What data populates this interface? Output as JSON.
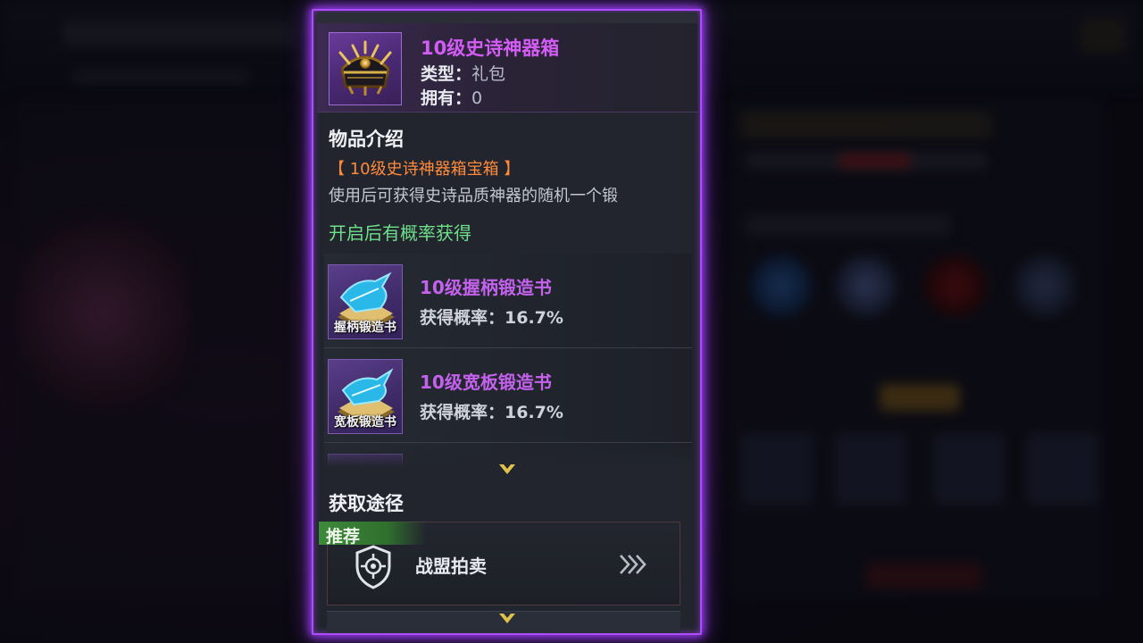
{
  "item": {
    "name": "10级史诗神器箱",
    "type_key": "类型：",
    "type_value": "礼包",
    "owned_key": "拥有：",
    "owned_value": "0",
    "icon": "ornate-chest-icon",
    "rarity_color": "#d45cf6"
  },
  "description": {
    "title": "物品介绍",
    "subtitle": "【 10级史诗神器箱宝箱 】",
    "text": "使用后可获得史诗品质神器的随机一个锻",
    "possible_rewards_label": "开启后有概率获得"
  },
  "rewards": [
    {
      "name": "10级握柄锻造书",
      "icon_label": "握柄锻造书",
      "prob_key": "获得概率：",
      "prob_value": "16.7%",
      "icon": "forge-book-icon"
    },
    {
      "name": "10级宽板锻造书",
      "icon_label": "宽板锻造书",
      "prob_key": "获得概率：",
      "prob_value": "16.7%",
      "icon": "forge-book-icon"
    }
  ],
  "acquire": {
    "title": "获取途径",
    "recommended_badge": "推荐",
    "source_label": "战盟拍卖",
    "source_icon": "guild-shield-icon",
    "go_icon": "triple-chevron-right-icon"
  },
  "colors": {
    "border_glow": "#b04cff",
    "orange": "#ff8a3c",
    "green": "#6fe08a",
    "badge_green": "#3d8a3a"
  }
}
